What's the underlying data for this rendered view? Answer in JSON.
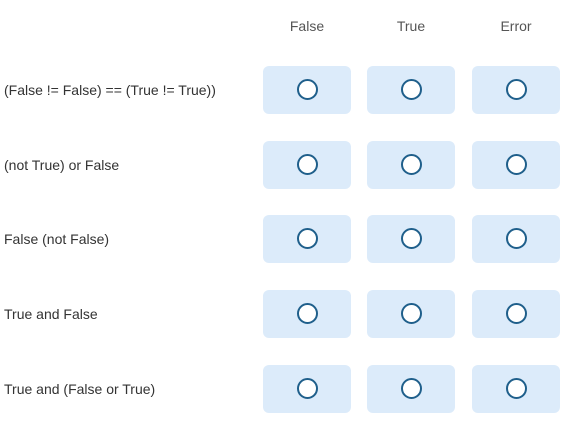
{
  "columns": [
    "False",
    "True",
    "Error"
  ],
  "rows": [
    {
      "label": "(False != False) == (True != True))"
    },
    {
      "label": "(not True) or False"
    },
    {
      "label": "False (not False)"
    },
    {
      "label": "True and False"
    },
    {
      "label": "True and (False or True)"
    }
  ],
  "colors": {
    "cell_background": "#dcebfa",
    "radio_border": "#1f5f8b"
  },
  "icons": {
    "radio": "radio-empty-icon"
  }
}
